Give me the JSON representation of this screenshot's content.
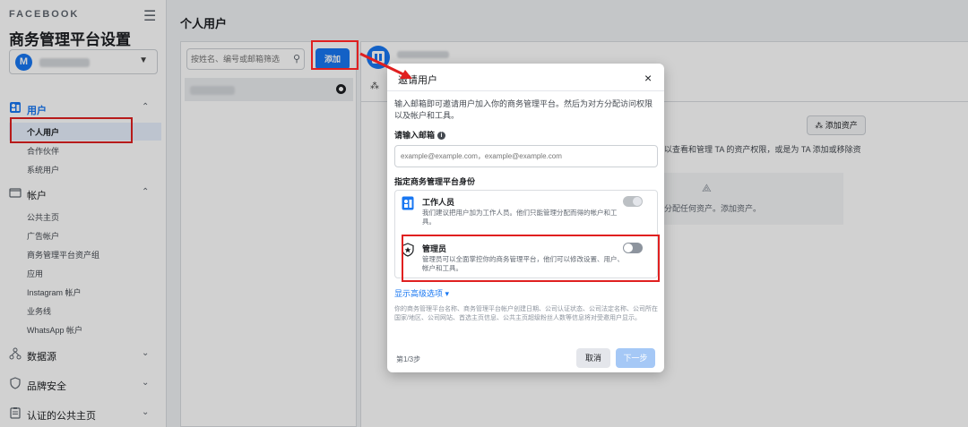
{
  "sidebar": {
    "brand": "FACEBOOK",
    "title": "商务管理平台设置",
    "account_initial": "M",
    "sections": [
      {
        "label": "用户",
        "items": [
          "个人用户",
          "合作伙伴",
          "系统用户"
        ]
      },
      {
        "label": "帐户",
        "items": [
          "公共主页",
          "广告帐户",
          "商务管理平台资产组",
          "应用",
          "Instagram 帐户",
          "业务线",
          "WhatsApp 帐户"
        ]
      },
      {
        "label": "数据源"
      },
      {
        "label": "品牌安全"
      },
      {
        "label": "认证的公共主页"
      }
    ]
  },
  "main": {
    "title": "个人用户",
    "search_placeholder": "按姓名、编号或邮箱筛选",
    "add_label": "添加",
    "detail": {
      "add_assets": "添加资产",
      "desc": "以查看和管理 TA 的资产权限，或是为 TA 添加或移除资",
      "empty_text": "分配任何资产。添加资产。"
    }
  },
  "modal": {
    "title": "邀请用户",
    "close": "×",
    "description": "输入邮箱即可邀请用户加入你的商务管理平台。然后为对方分配访问权限以及帐户和工具。",
    "email_label": "请输入邮箱",
    "email_placeholder": "example@example.com，example@example.com",
    "role_label": "指定商务管理平台身份",
    "roles": [
      {
        "name": "工作人员",
        "desc": "我们建议把用户加为工作人员。他们只能管理分配而得的帐户和工具。",
        "on": true
      },
      {
        "name": "管理员",
        "desc": "管理员可以全面掌控你的商务管理平台，他们可以修改设置、用户、帐户和工具。",
        "on": false
      }
    ],
    "advanced_link": "显示高级选项 ▾",
    "disclaimer": "你的商务管理平台名称、商务管理平台帐户创建日期、公司认证状态、公司法定名称、公司所在国家/地区、公司网站、首选主页信息、公共主页超级粉丝人数等信息将对受邀用户显示。",
    "step": "第1/3步",
    "cancel": "取消",
    "next": "下一步"
  },
  "colors": {
    "accent": "#1877f2",
    "highlight": "#e02020"
  }
}
